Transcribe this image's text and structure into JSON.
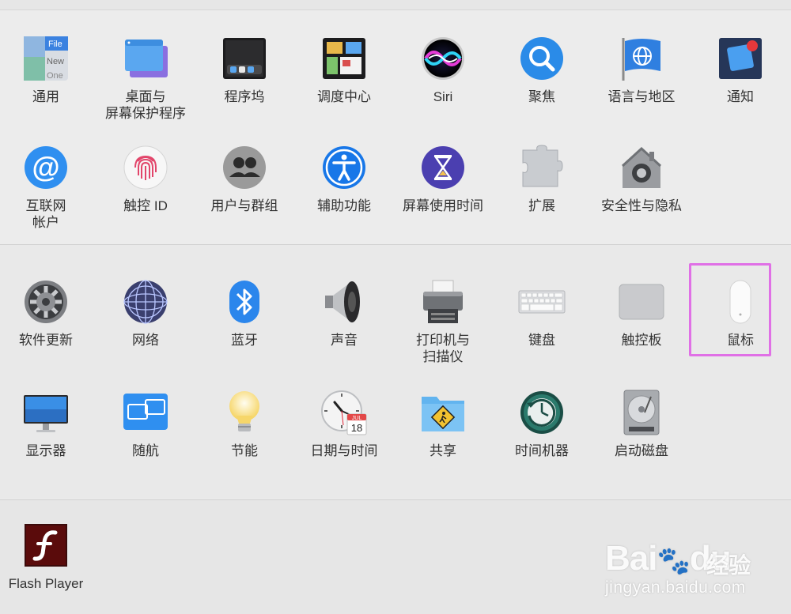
{
  "section_system": [
    {
      "id": "general",
      "label": "通用",
      "icon": "general-icon"
    },
    {
      "id": "desktop-screensaver",
      "label": "桌面与\n屏幕保护程序",
      "icon": "desktop-screensaver-icon"
    },
    {
      "id": "dock",
      "label": "程序坞",
      "icon": "dock-icon"
    },
    {
      "id": "mission-control",
      "label": "调度中心",
      "icon": "mission-control-icon"
    },
    {
      "id": "siri",
      "label": "Siri",
      "icon": "siri-icon"
    },
    {
      "id": "spotlight",
      "label": "聚焦",
      "icon": "spotlight-icon"
    },
    {
      "id": "language-region",
      "label": "语言与地区",
      "icon": "language-region-icon"
    },
    {
      "id": "notifications",
      "label": "通知",
      "icon": "notifications-icon"
    },
    {
      "id": "internet-accounts",
      "label": "互联网\n帐户",
      "icon": "internet-accounts-icon"
    },
    {
      "id": "touch-id",
      "label": "触控 ID",
      "icon": "touch-id-icon"
    },
    {
      "id": "users-groups",
      "label": "用户与群组",
      "icon": "users-groups-icon"
    },
    {
      "id": "accessibility",
      "label": "辅助功能",
      "icon": "accessibility-icon"
    },
    {
      "id": "screen-time",
      "label": "屏幕使用时间",
      "icon": "screen-time-icon"
    },
    {
      "id": "extensions",
      "label": "扩展",
      "icon": "extensions-icon"
    },
    {
      "id": "security-privacy",
      "label": "安全性与隐私",
      "icon": "security-privacy-icon"
    }
  ],
  "section_hardware": [
    {
      "id": "software-update",
      "label": "软件更新",
      "icon": "software-update-icon"
    },
    {
      "id": "network",
      "label": "网络",
      "icon": "network-icon"
    },
    {
      "id": "bluetooth",
      "label": "蓝牙",
      "icon": "bluetooth-icon"
    },
    {
      "id": "sound",
      "label": "声音",
      "icon": "sound-icon"
    },
    {
      "id": "printers-scanners",
      "label": "打印机与\n扫描仪",
      "icon": "printer-icon"
    },
    {
      "id": "keyboard",
      "label": "键盘",
      "icon": "keyboard-icon"
    },
    {
      "id": "trackpad",
      "label": "触控板",
      "icon": "trackpad-icon"
    },
    {
      "id": "mouse",
      "label": "鼠标",
      "icon": "mouse-icon"
    },
    {
      "id": "displays",
      "label": "显示器",
      "icon": "display-icon"
    },
    {
      "id": "sidecar",
      "label": "随航",
      "icon": "sidecar-icon"
    },
    {
      "id": "energy-saver",
      "label": "节能",
      "icon": "lightbulb-icon"
    },
    {
      "id": "date-time",
      "label": "日期与时间",
      "icon": "clock-calendar-icon"
    },
    {
      "id": "sharing",
      "label": "共享",
      "icon": "sharing-folder-icon"
    },
    {
      "id": "time-machine",
      "label": "时间机器",
      "icon": "time-machine-icon"
    },
    {
      "id": "startup-disk",
      "label": "启动磁盘",
      "icon": "hard-disk-icon"
    }
  ],
  "section_other": [
    {
      "id": "flash-player",
      "label": "Flash Player",
      "icon": "flash-icon"
    }
  ],
  "icon_text": {
    "general_file": "File",
    "general_new": "New",
    "general_one": "One",
    "calendar_month": "JUL",
    "calendar_day": "18"
  },
  "highlighted_item": "mouse",
  "highlight_color": "#e070e6",
  "watermark": {
    "logo": "Bai",
    "logo_tail": "du",
    "cn": "经验",
    "url": "jingyan.baidu.com"
  }
}
